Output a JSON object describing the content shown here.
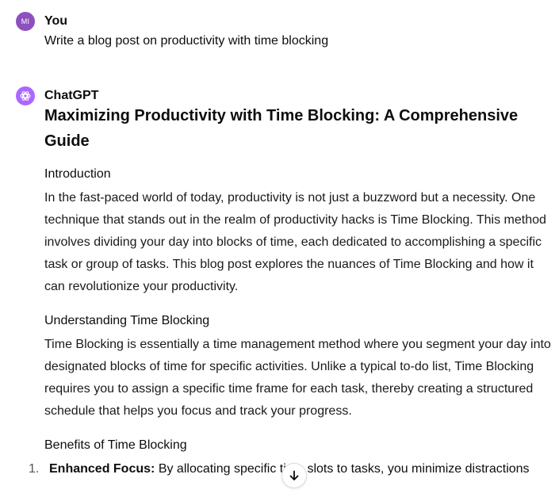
{
  "user_message": {
    "avatar_initials": "MI",
    "author": "You",
    "text": "Write a blog post on productivity with time blocking"
  },
  "assistant_message": {
    "author": "ChatGPT",
    "avatar_icon": "openai-logo-icon",
    "title": "Maximizing Productivity with Time Blocking: A Comprehensive Guide",
    "sections": [
      {
        "heading": "Introduction",
        "body": "In the fast-paced world of today, productivity is not just a buzzword but a necessity. One technique that stands out in the realm of productivity hacks is Time Blocking. This method involves dividing your day into blocks of time, each dedicated to accomplishing a specific task or group of tasks. This blog post explores the nuances of Time Blocking and how it can revolutionize your productivity."
      },
      {
        "heading": "Understanding Time Blocking",
        "body": "Time Blocking is essentially a time management method where you segment your day into designated blocks of time for specific activities. Unlike a typical to-do list, Time Blocking requires you to assign a specific time frame for each task, thereby creating a structured schedule that helps you focus and track your progress."
      },
      {
        "heading": "Benefits of Time Blocking"
      }
    ],
    "benefits": [
      {
        "number": "1.",
        "label": "Enhanced Focus:",
        "text": "By allocating specific time slots to tasks, you minimize distractions"
      }
    ]
  },
  "scroll_button_icon": "arrow-down-icon",
  "colors": {
    "user_avatar": "#8e4fbf",
    "assistant_avatar": "#ab68ff",
    "text": "#0d0d0d"
  }
}
